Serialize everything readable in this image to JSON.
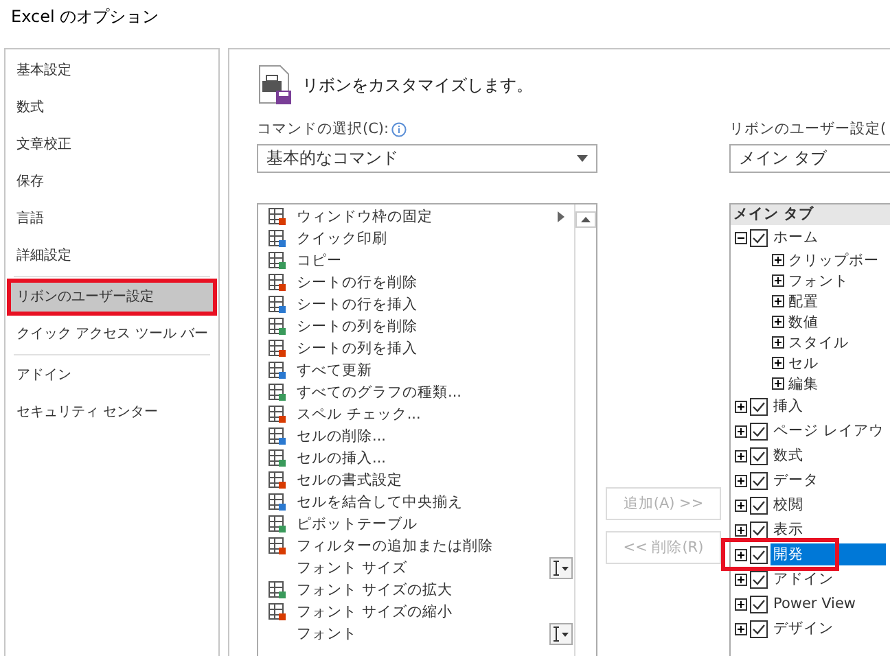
{
  "window": {
    "title": "Excel のオプション"
  },
  "sidebar": {
    "groups": [
      {
        "items": [
          {
            "label": "基本設定",
            "selected": false,
            "highlighted": false
          },
          {
            "label": "数式",
            "selected": false,
            "highlighted": false
          },
          {
            "label": "文章校正",
            "selected": false,
            "highlighted": false
          },
          {
            "label": "保存",
            "selected": false,
            "highlighted": false
          },
          {
            "label": "言語",
            "selected": false,
            "highlighted": false
          },
          {
            "label": "詳細設定",
            "selected": false,
            "highlighted": false
          }
        ]
      },
      {
        "items": [
          {
            "label": "リボンのユーザー設定",
            "selected": true,
            "highlighted": true
          },
          {
            "label": "クイック アクセス ツール バー",
            "selected": false,
            "highlighted": false
          }
        ]
      },
      {
        "items": [
          {
            "label": "アドイン",
            "selected": false,
            "highlighted": false
          },
          {
            "label": "セキュリティ センター",
            "selected": false,
            "highlighted": false
          }
        ]
      }
    ]
  },
  "heading": "リボンをカスタマイズします。",
  "commands": {
    "label": "コマンドの選択(C):",
    "dropdown": {
      "value": "基本的なコマンド"
    },
    "items": [
      {
        "label": "ウィンドウ枠の固定",
        "icon": true,
        "kind": "submenu"
      },
      {
        "label": "クイック印刷",
        "icon": true,
        "kind": "plain"
      },
      {
        "label": "コピー",
        "icon": true,
        "kind": "plain"
      },
      {
        "label": "シートの行を削除",
        "icon": true,
        "kind": "plain"
      },
      {
        "label": "シートの行を挿入",
        "icon": true,
        "kind": "plain"
      },
      {
        "label": "シートの列を削除",
        "icon": true,
        "kind": "plain"
      },
      {
        "label": "シートの列を挿入",
        "icon": true,
        "kind": "plain"
      },
      {
        "label": "すべて更新",
        "icon": true,
        "kind": "plain"
      },
      {
        "label": "すべてのグラフの種類...",
        "icon": true,
        "kind": "plain"
      },
      {
        "label": "スペル チェック...",
        "icon": true,
        "kind": "plain"
      },
      {
        "label": "セルの削除...",
        "icon": true,
        "kind": "plain"
      },
      {
        "label": "セルの挿入...",
        "icon": true,
        "kind": "plain"
      },
      {
        "label": "セルの書式設定",
        "icon": true,
        "kind": "plain"
      },
      {
        "label": "セルを結合して中央揃え",
        "icon": true,
        "kind": "plain"
      },
      {
        "label": "ピボットテーブル",
        "icon": true,
        "kind": "plain"
      },
      {
        "label": "フィルターの追加または削除",
        "icon": true,
        "kind": "plain"
      },
      {
        "label": "フォント サイズ",
        "icon": false,
        "kind": "combo"
      },
      {
        "label": "フォント サイズの拡大",
        "icon": true,
        "kind": "plain"
      },
      {
        "label": "フォント サイズの縮小",
        "icon": true,
        "kind": "plain"
      },
      {
        "label": "フォント",
        "icon": false,
        "kind": "combo"
      }
    ]
  },
  "buttons": [
    {
      "label": "追加(A) >>",
      "disabled": true
    },
    {
      "label": "<< 削除(R)",
      "disabled": true
    }
  ],
  "ribbon": {
    "label": "リボンのユーザー設定(",
    "dropdown": {
      "value": "メイン タブ"
    },
    "header": "メイン タブ",
    "tabs": [
      {
        "label": "ホーム",
        "checked": true,
        "expanded": true,
        "selected": false,
        "highlighted": false,
        "children": [
          {
            "label": "クリップボー",
            "expanded": false
          },
          {
            "label": "フォント",
            "expanded": false
          },
          {
            "label": "配置",
            "expanded": false
          },
          {
            "label": "数値",
            "expanded": false
          },
          {
            "label": "スタイル",
            "expanded": false
          },
          {
            "label": "セル",
            "expanded": false
          },
          {
            "label": "編集",
            "expanded": false
          }
        ]
      },
      {
        "label": "挿入",
        "checked": true,
        "expanded": false,
        "selected": false,
        "highlighted": false
      },
      {
        "label": "ページ レイアウ",
        "checked": true,
        "expanded": false,
        "selected": false,
        "highlighted": false
      },
      {
        "label": "数式",
        "checked": true,
        "expanded": false,
        "selected": false,
        "highlighted": false
      },
      {
        "label": "データ",
        "checked": true,
        "expanded": false,
        "selected": false,
        "highlighted": false
      },
      {
        "label": "校閲",
        "checked": true,
        "expanded": false,
        "selected": false,
        "highlighted": false
      },
      {
        "label": "表示",
        "checked": true,
        "expanded": false,
        "selected": false,
        "highlighted": false
      },
      {
        "label": "開発",
        "checked": true,
        "expanded": false,
        "selected": true,
        "highlighted": true
      },
      {
        "label": "アドイン",
        "checked": true,
        "expanded": false,
        "selected": false,
        "highlighted": false
      },
      {
        "label": "Power View",
        "checked": true,
        "expanded": false,
        "selected": false,
        "highlighted": false
      },
      {
        "label": "デザイン",
        "checked": true,
        "expanded": false,
        "selected": false,
        "highlighted": false
      }
    ]
  }
}
